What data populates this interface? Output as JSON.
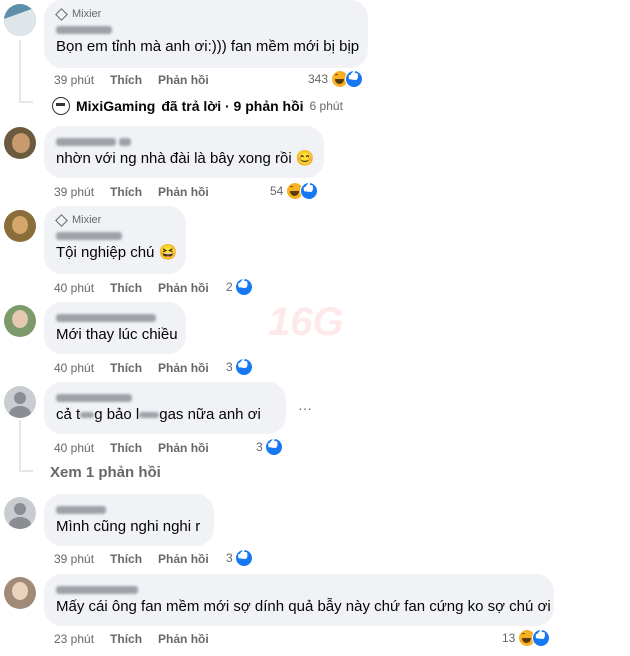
{
  "comments": [
    {
      "badge": "Mixier",
      "text": "Bọn em tỉnh mà anh ơi:))) fan mềm mới bị bịp",
      "time": "39 phút",
      "like": "Thích",
      "reply": "Phản hồi",
      "count": "343"
    },
    {
      "text": "nhờn với ng nhà đài là bây xong rồi 😊",
      "time": "39 phút",
      "like": "Thích",
      "reply": "Phản hồi",
      "count": "54"
    },
    {
      "badge": "Mixier",
      "text": "Tội nghiệp chú 😆",
      "time": "40 phút",
      "like": "Thích",
      "reply": "Phản hồi",
      "count": "2"
    },
    {
      "text": "Mới thay lúc chiều",
      "time": "40 phút",
      "like": "Thích",
      "reply": "Phản hồi",
      "count": "3"
    },
    {
      "text_pre": "cả t",
      "text_mid": "g bảo l",
      "text_post": "gas nữa anh ơi",
      "time": "40 phút",
      "like": "Thích",
      "reply": "Phản hồi",
      "count": "3"
    },
    {
      "text": "Mình cũng nghi nghi r",
      "time": "39 phút",
      "like": "Thích",
      "reply": "Phản hồi",
      "count": "3"
    },
    {
      "text": "Mấy cái ông fan mềm mới sợ dính quả bẫy này chứ fan cứng ko sợ chú ơi",
      "time": "23 phút",
      "like": "Thích",
      "reply": "Phản hồi",
      "count": "13"
    }
  ],
  "reply_summary": {
    "name": "MixiGaming",
    "action": "đã trả lời · 9 phản hồi",
    "time": "6 phút"
  },
  "view_replies": "Xem 1 phản hồi",
  "more": "···",
  "watermark": "16G",
  "colors": {
    "bubble": "#f0f2f5",
    "meta": "#65676b",
    "like": "#1877f2",
    "haha": "#f7b125"
  }
}
